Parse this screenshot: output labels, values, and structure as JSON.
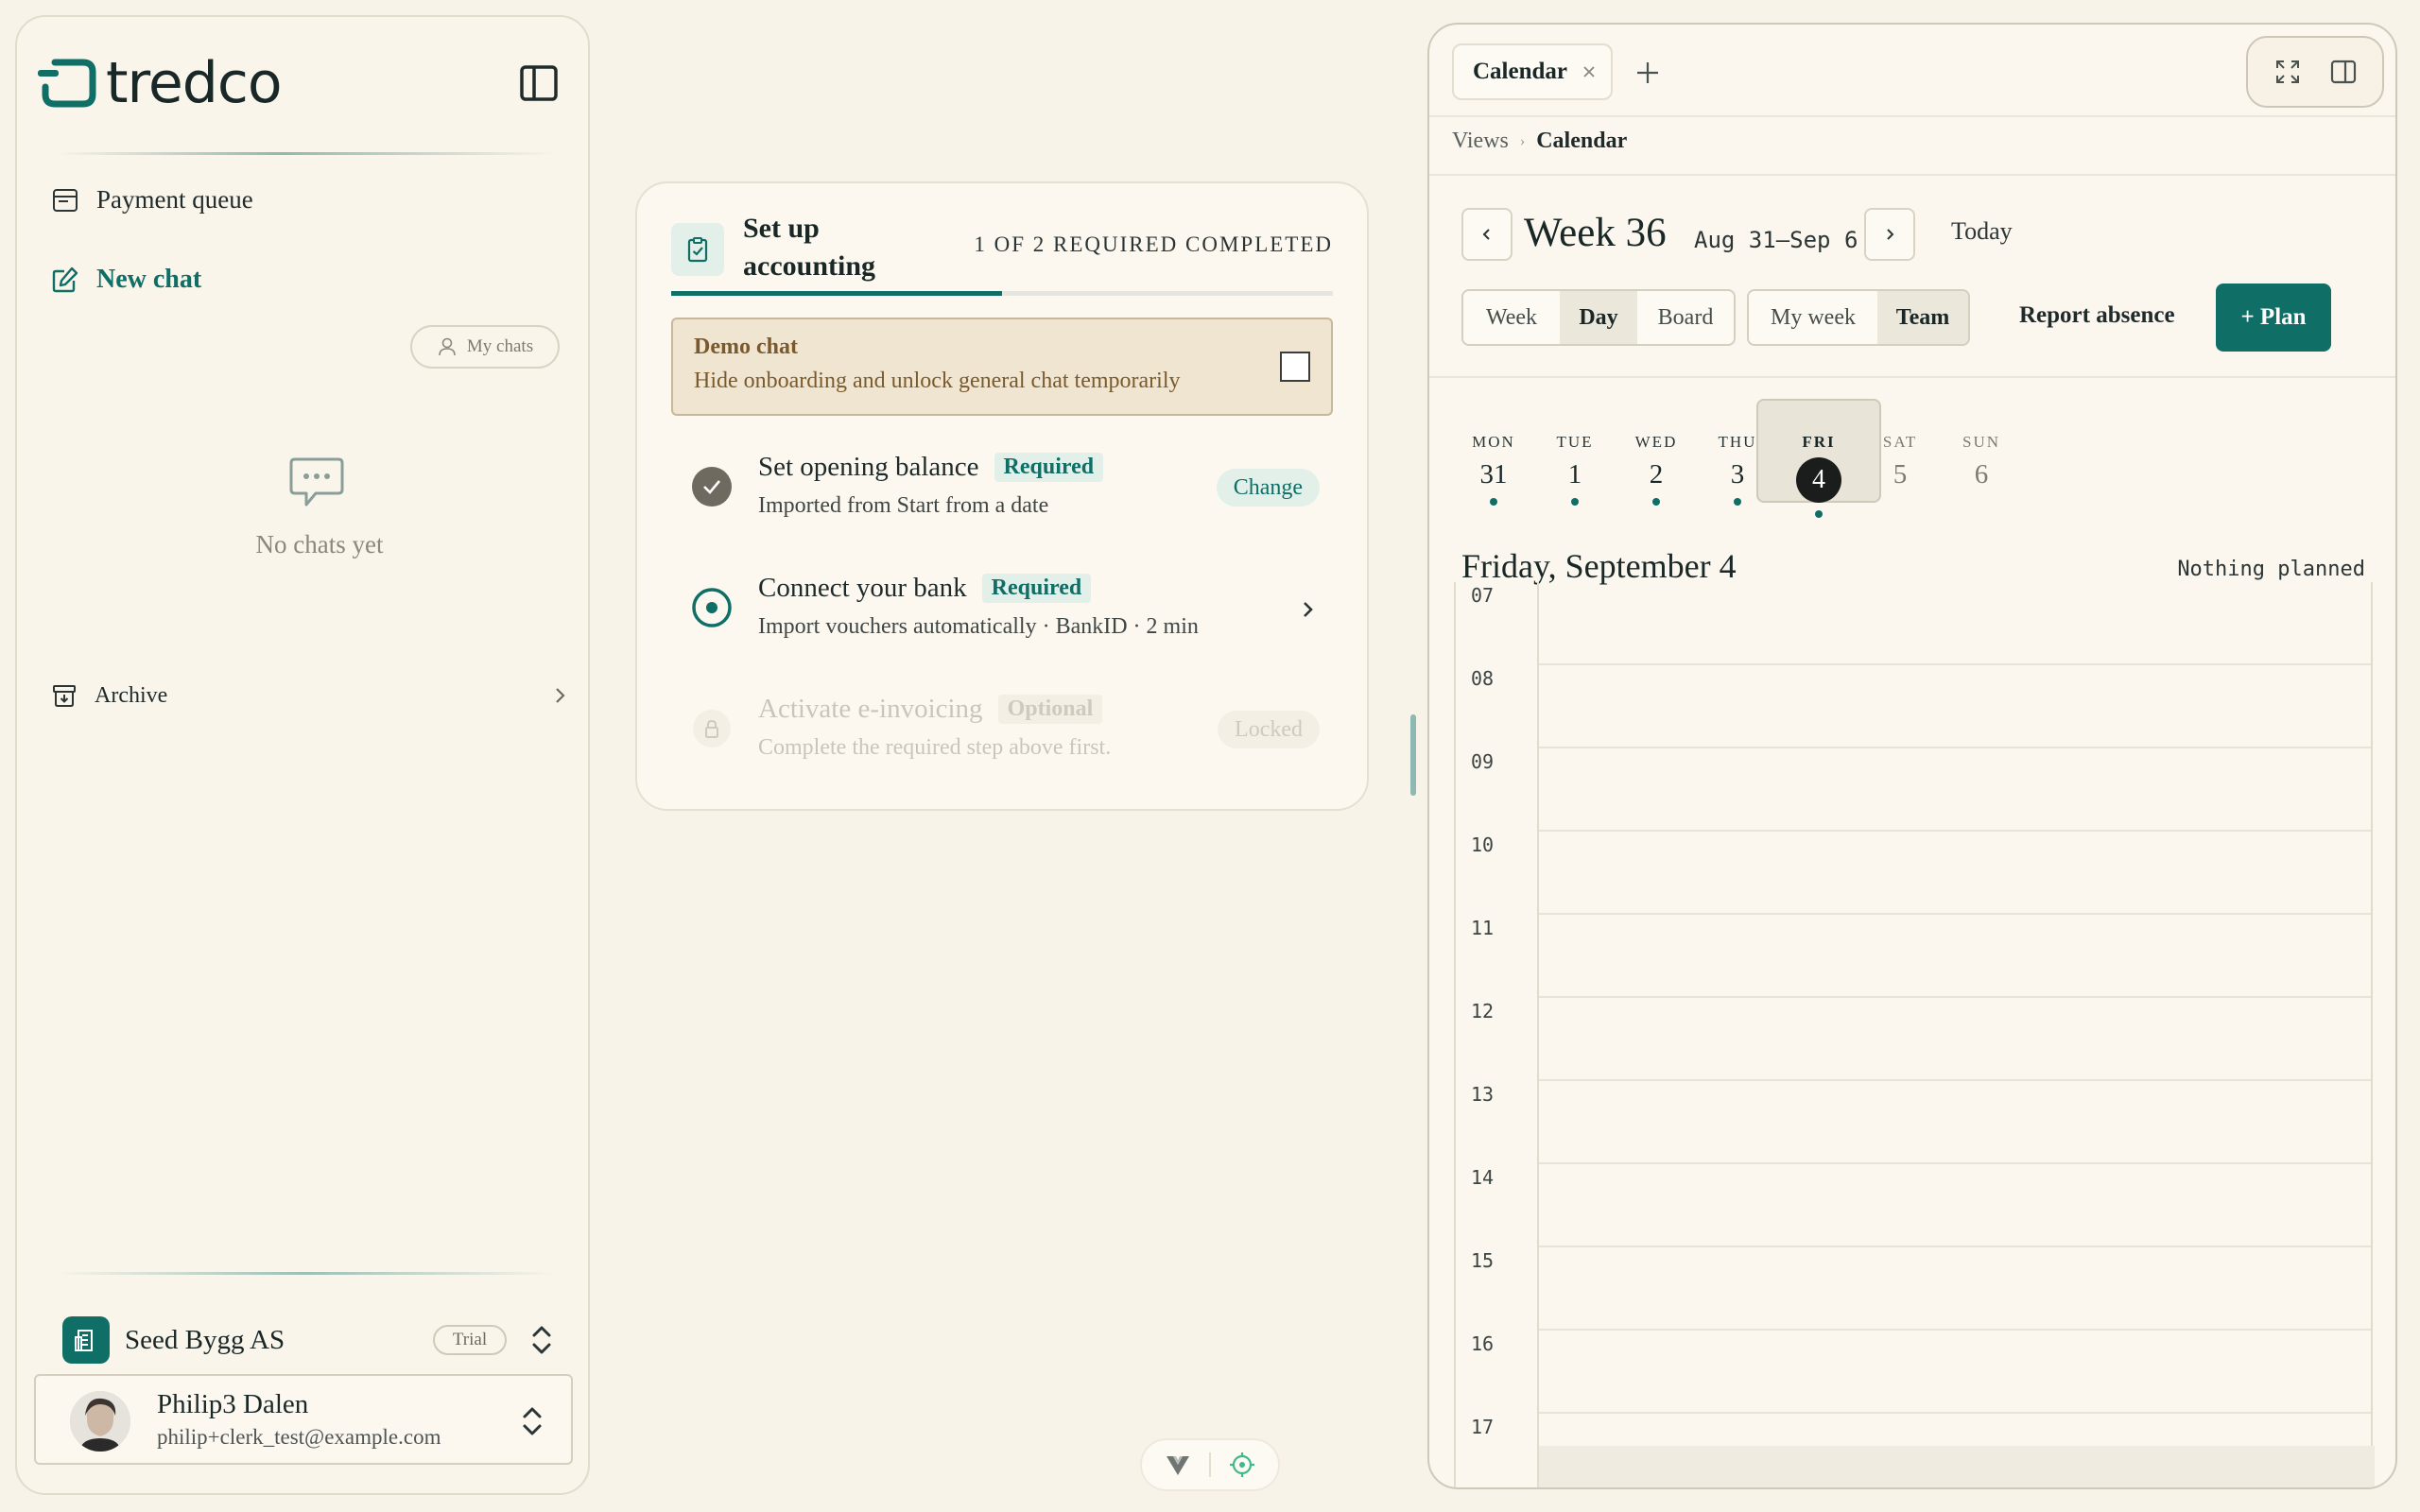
{
  "sidebar": {
    "brand": "tredco",
    "payment_queue": "Payment queue",
    "new_chat": "New chat",
    "my_chats": "My chats",
    "empty_text": "No chats yet",
    "archive": "Archive",
    "company": {
      "name": "Seed Bygg AS",
      "plan": "Trial"
    },
    "user": {
      "name": "Philip3 Dalen",
      "email": "philip+clerk_test@example.com"
    }
  },
  "onboarding": {
    "title": "Set up accounting",
    "progress_text": "1 OF 2 REQUIRED COMPLETED",
    "progress_fraction": 0.5,
    "demo": {
      "title": "Demo chat",
      "description": "Hide onboarding and unlock general chat temporarily",
      "checked": false
    },
    "steps": [
      {
        "title": "Set opening balance",
        "badge": "Required",
        "subtitle": "Imported from Start from a date",
        "action": "Change",
        "status": "done"
      },
      {
        "title": "Connect your bank",
        "badge": "Required",
        "subtitle": "Import vouchers automatically · BankID · 2 min",
        "status": "current"
      },
      {
        "title": "Activate e-invoicing",
        "badge": "Optional",
        "subtitle": "Complete the required step above first.",
        "action": "Locked",
        "status": "locked"
      }
    ]
  },
  "calendar": {
    "tab_label": "Calendar",
    "breadcrumb": [
      "Views",
      "Calendar"
    ],
    "week_title": "Week 36",
    "week_range": "Aug 31–Sep 6",
    "today_label": "Today",
    "view_modes": [
      "Week",
      "Day",
      "Board"
    ],
    "active_view": "Day",
    "scopes": [
      "My week",
      "Team"
    ],
    "active_scope": "Team",
    "report_absence": "Report absence",
    "plan_button": "+ Plan",
    "days": [
      {
        "name": "MON",
        "date": "31",
        "has_event": true
      },
      {
        "name": "TUE",
        "date": "1",
        "has_event": true
      },
      {
        "name": "WED",
        "date": "2",
        "has_event": true
      },
      {
        "name": "THU",
        "date": "3",
        "has_event": true
      },
      {
        "name": "FRI",
        "date": "4",
        "has_event": true,
        "selected": true
      },
      {
        "name": "SAT",
        "date": "5",
        "has_event": false
      },
      {
        "name": "SUN",
        "date": "6",
        "has_event": false
      }
    ],
    "day_title": "Friday, September 4",
    "day_status": "Nothing planned",
    "hours": [
      "07",
      "08",
      "09",
      "10",
      "11",
      "12",
      "13",
      "14",
      "15",
      "16",
      "17"
    ]
  },
  "colors": {
    "accent": "#0f6e66",
    "background": "#f8f3e8",
    "demo_bg": "#f0e5d1",
    "demo_text": "#7a5a2c"
  }
}
